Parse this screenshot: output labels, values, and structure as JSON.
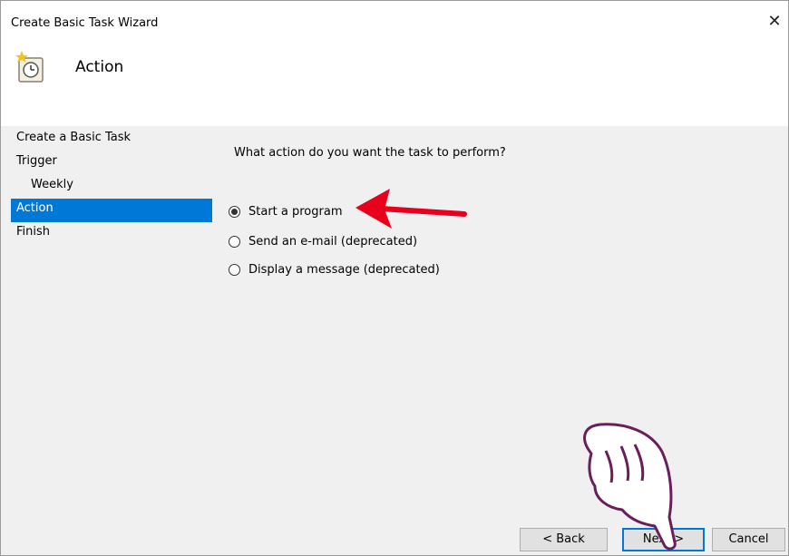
{
  "window": {
    "title": "Create Basic Task Wizard",
    "close_glyph": "✕"
  },
  "header": {
    "heading": "Action",
    "icon": "scheduled-task-clock-icon"
  },
  "steps": [
    {
      "label": "Create a Basic Task",
      "active": false,
      "sub": false
    },
    {
      "label": "Trigger",
      "active": false,
      "sub": false
    },
    {
      "label": "Weekly",
      "active": false,
      "sub": true
    },
    {
      "label": "Action",
      "active": true,
      "sub": false
    },
    {
      "label": "Finish",
      "active": false,
      "sub": false
    }
  ],
  "main": {
    "question": "What action do you want the task to perform?",
    "options": [
      {
        "label": "Start a program",
        "checked": true
      },
      {
        "label": "Send an e-mail (deprecated)",
        "checked": false
      },
      {
        "label": "Display a message (deprecated)",
        "checked": false
      }
    ]
  },
  "buttons": {
    "back": "< Back",
    "next": "Next >",
    "cancel": "Cancel"
  },
  "colors": {
    "accent": "#0078d7",
    "annotation_arrow": "#e8001c",
    "hand_outline": "#6a1e5a"
  }
}
